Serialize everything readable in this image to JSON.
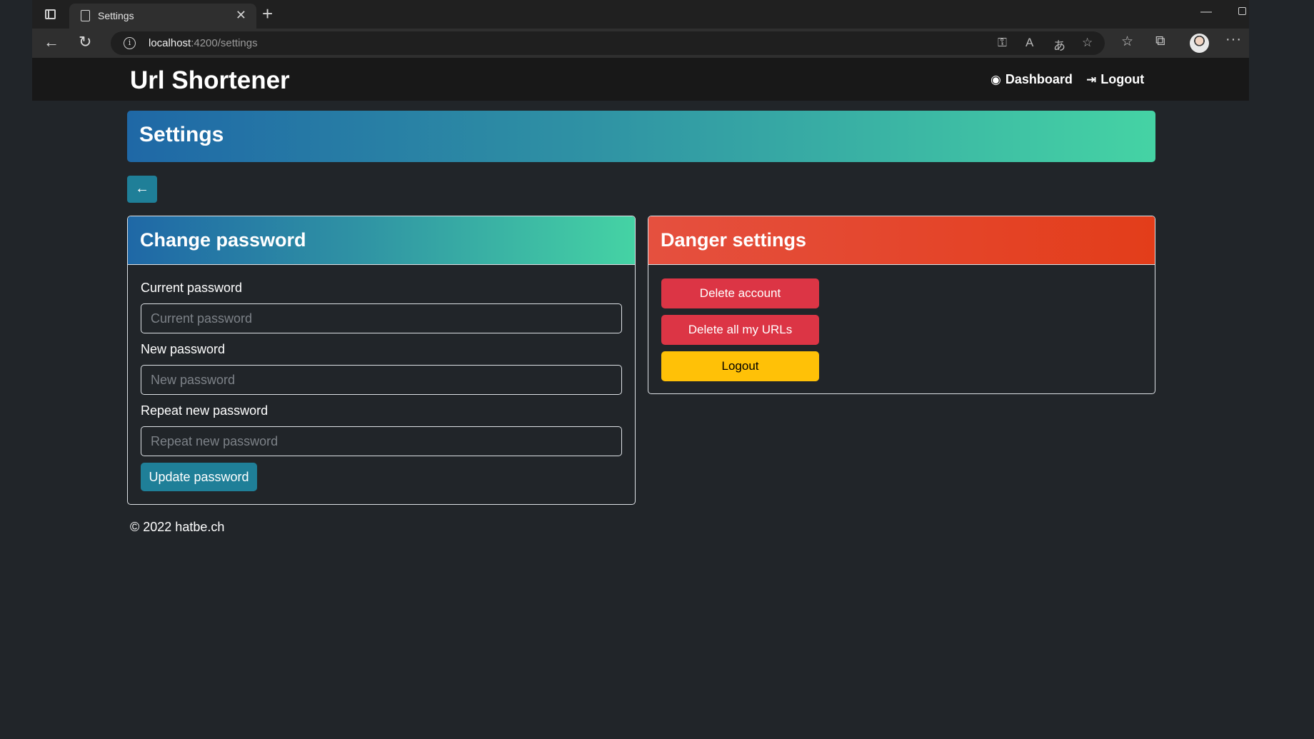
{
  "browser": {
    "tab_title": "Settings",
    "tab_close": "✕",
    "new_tab": "+",
    "url_host": "localhost",
    "url_path": ":4200/settings"
  },
  "navbar": {
    "brand": "Url Shortener",
    "dashboard_label": "Dashboard",
    "logout_label": "Logout"
  },
  "page": {
    "title": "Settings",
    "back_icon": "arrow-left-icon"
  },
  "change_password": {
    "title": "Change password",
    "fields": [
      {
        "label": "Current password",
        "placeholder": "Current password"
      },
      {
        "label": "New password",
        "placeholder": "New password"
      },
      {
        "label": "Repeat new password",
        "placeholder": "Repeat new password"
      }
    ],
    "submit_label": "Update password"
  },
  "danger": {
    "title": "Danger settings",
    "delete_account_label": "Delete account",
    "delete_urls_label": "Delete all my URLs",
    "logout_label": "Logout"
  },
  "footer": {
    "text": "© 2022 hatbe.ch"
  },
  "colors": {
    "background": "#212529",
    "accent_teal": "#1f7f98",
    "gradient_start": "#1f68a6",
    "gradient_end": "#45d3a4",
    "danger_red": "#dc3545",
    "warning_yellow": "#ffc107"
  }
}
